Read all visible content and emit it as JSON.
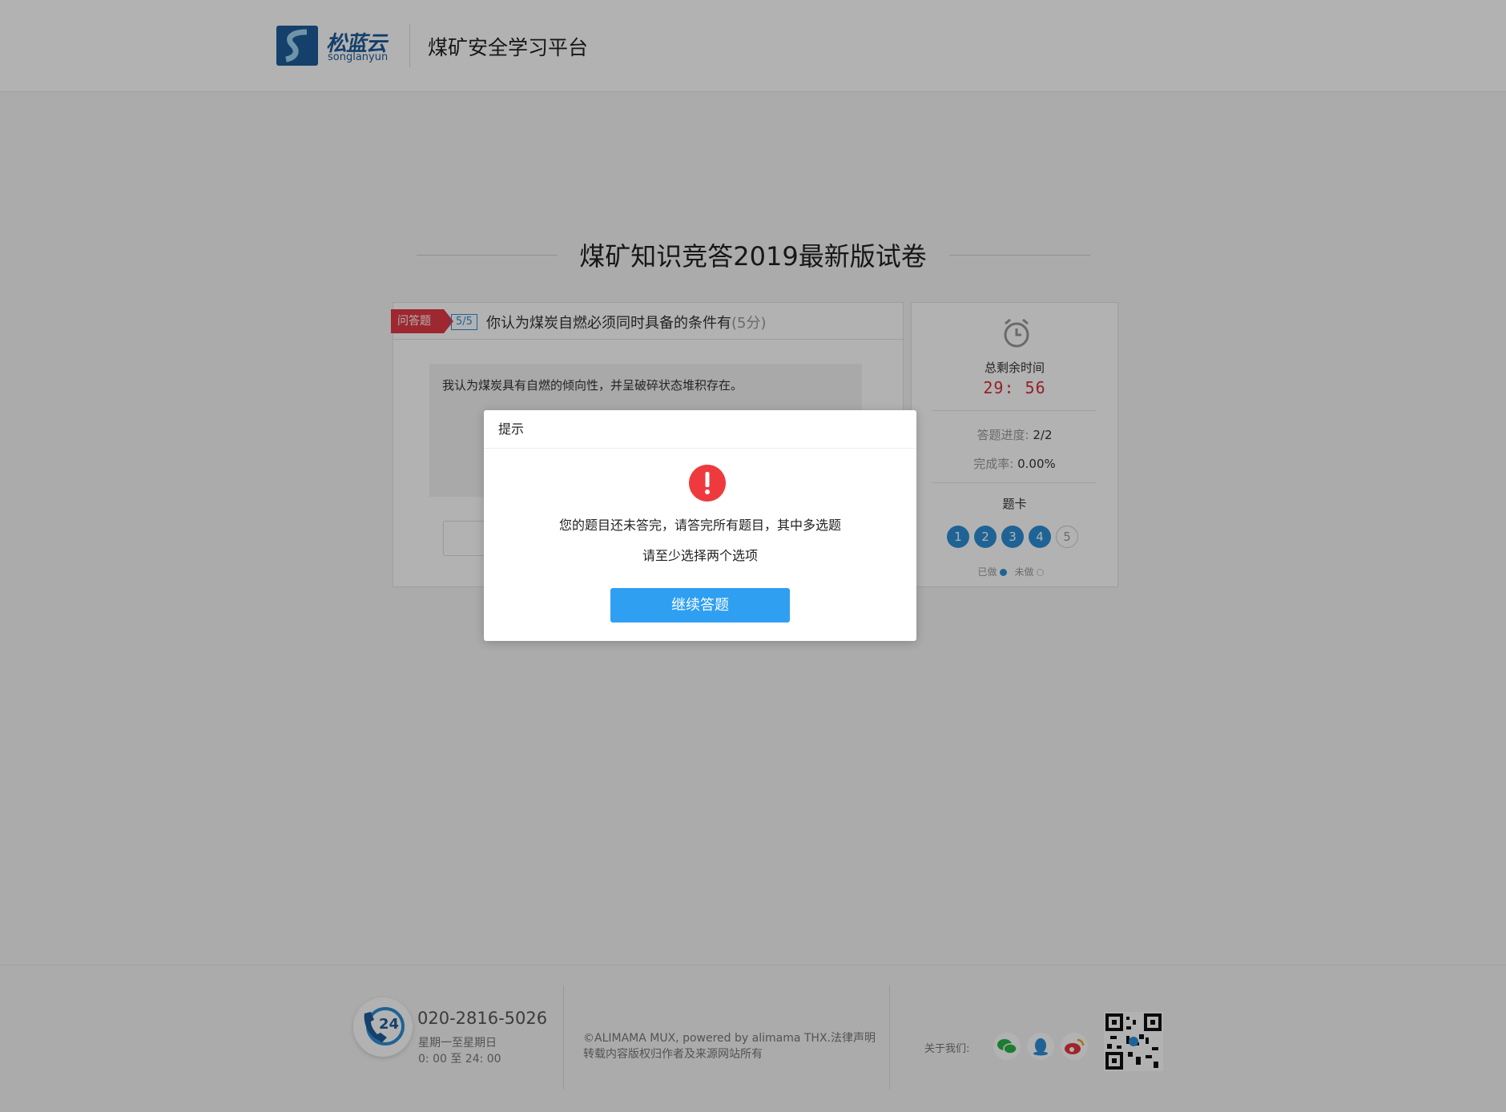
{
  "header": {
    "logo_cn": "松蓝云",
    "logo_en": "songlanyun",
    "site_title": "煤矿安全学习平台"
  },
  "exam": {
    "title": "煤矿知识竞答2019最新版试卷"
  },
  "question": {
    "type_tag": "问答题",
    "number": "5/5",
    "text": "你认为煤炭自燃必须同时具备的条件有",
    "score": "(5分)",
    "answer": "我认为煤炭具有自燃的倾向性，并呈破碎状态堆积存在。"
  },
  "sidebar": {
    "time_label": "总剩余时间",
    "time_value": "29: 56",
    "progress_key": "答题进度:",
    "progress_value": "2/2",
    "rate_key": "完成率:",
    "rate_value": "0.00%",
    "card_label": "题卡",
    "cards": [
      {
        "label": "1",
        "status": "done"
      },
      {
        "label": "2",
        "status": "done"
      },
      {
        "label": "3",
        "status": "done"
      },
      {
        "label": "4",
        "status": "done"
      },
      {
        "label": "5",
        "status": "todo"
      }
    ],
    "legend_done": "已做",
    "legend_todo": "未做"
  },
  "footer": {
    "phone": "020-2816-5026",
    "days": "星期一至星期日",
    "hours": "0: 00 至 24: 00",
    "badge": "24",
    "copyright": "©ALIMAMA MUX, powered by alimama THX.法律声明",
    "notice": "转载内容版权归作者及来源网站所有",
    "about": "关于我们:"
  },
  "modal": {
    "title": "提示",
    "message_1": "您的题目还未答完，请答完所有题目，其中多选题",
    "message_2": "请至少选择两个选项",
    "button": "继续答题"
  },
  "colors": {
    "primary": "#2f9ff2",
    "accent_red": "#e23a46",
    "card_blue": "#2d8fd6"
  }
}
